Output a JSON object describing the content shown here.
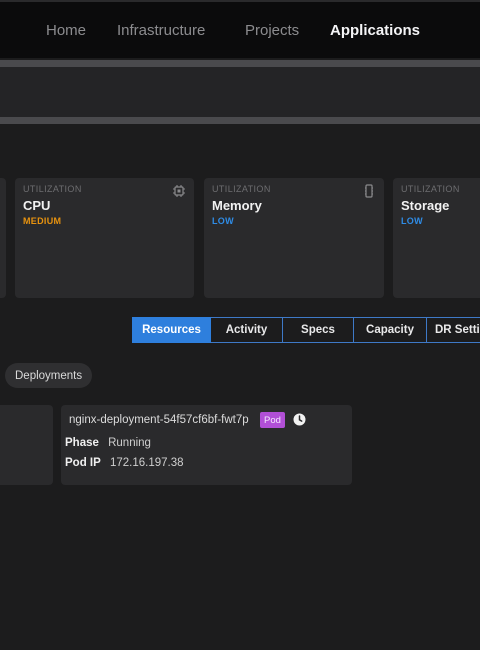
{
  "nav": {
    "items": [
      "Home",
      "Infrastructure",
      "Projects",
      "Applications"
    ],
    "active": "Applications"
  },
  "utilization": {
    "cards": [
      {
        "eyebrow": "UTILIZATION",
        "name": "CPU",
        "level": "MEDIUM",
        "level_color": "#e8930f",
        "icon": "chip-icon"
      },
      {
        "eyebrow": "UTILIZATION",
        "name": "Memory",
        "level": "LOW",
        "level_color": "#2f8ce6",
        "icon": "memory-icon"
      },
      {
        "eyebrow": "UTILIZATION",
        "name": "Storage",
        "level": "LOW",
        "level_color": "#2f8ce6",
        "icon": "storage-icon"
      }
    ]
  },
  "tabs": {
    "items": [
      "Resources",
      "Activity",
      "Specs",
      "Capacity",
      "DR Setti"
    ],
    "active": "Resources"
  },
  "filter": {
    "chip_label": "Deployments"
  },
  "pod": {
    "name": "nginx-deployment-54f57cf6bf-fwt7p",
    "badge": "Pod",
    "phase_label": "Phase",
    "phase_value": "Running",
    "ip_label": "Pod IP",
    "ip_value": "172.16.197.38"
  },
  "colors": {
    "accent": "#2e7fdd",
    "pod_badge": "#b14fd6"
  }
}
